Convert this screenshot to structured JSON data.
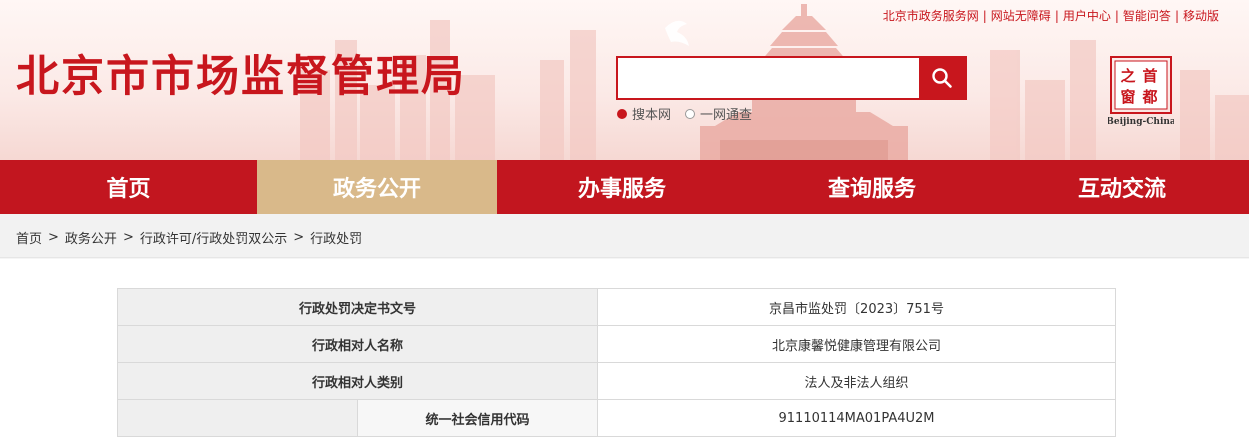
{
  "header": {
    "site_title": "北京市市场监督管理局",
    "top_links": [
      "北京市政务服务网",
      "网站无障碍",
      "用户中心",
      "智能问答",
      "移动版"
    ],
    "search": {
      "value": "",
      "placeholder": ""
    },
    "search_scopes": [
      {
        "label": "搜本网",
        "selected": true
      },
      {
        "label": "一网通查",
        "selected": false
      }
    ],
    "logo": {
      "line1": "首都",
      "line2": "之窗",
      "caption": "Beijing-China"
    },
    "brand_color": "#c8161d"
  },
  "nav": {
    "items": [
      "首页",
      "政务公开",
      "办事服务",
      "查询服务",
      "互动交流"
    ],
    "active_index": 1,
    "active_color": "#d9b98a"
  },
  "breadcrumb": [
    "首页",
    "政务公开",
    "行政许可/行政处罚双公示",
    "行政处罚"
  ],
  "detail": {
    "rows": [
      {
        "label": "行政处罚决定书文号",
        "value": "京昌市监处罚〔2023〕751号"
      },
      {
        "label": "行政相对人名称",
        "value": "北京康馨悦健康管理有限公司"
      },
      {
        "label": "行政相对人类别",
        "value": "法人及非法人组织"
      },
      {
        "label": "统一社会信用代码",
        "value": "91110114MA01PA4U2M"
      }
    ]
  }
}
